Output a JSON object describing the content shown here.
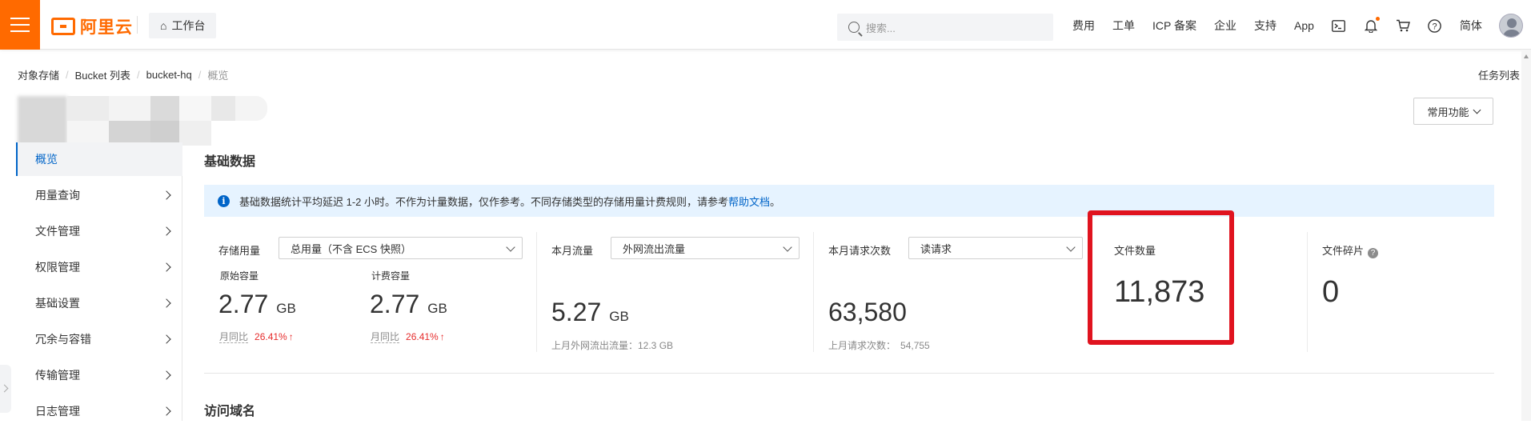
{
  "topbar": {
    "logo_text": "阿里云",
    "workbench_label": "工作台",
    "search_placeholder": "搜索...",
    "links": [
      "费用",
      "工单",
      "ICP 备案",
      "企业",
      "支持",
      "App"
    ],
    "icons": [
      "terminal-icon",
      "bell-icon",
      "cart-icon",
      "help-icon"
    ],
    "lang": "简体"
  },
  "breadcrumb": [
    "对象存储",
    "Bucket 列表",
    "bucket-hq",
    "概览"
  ],
  "task_list_label": "任务列表",
  "common_functions_label": "常用功能",
  "sidebar": {
    "items": [
      {
        "label": "概览",
        "active": true
      },
      {
        "label": "用量查询"
      },
      {
        "label": "文件管理"
      },
      {
        "label": "权限管理"
      },
      {
        "label": "基础设置"
      },
      {
        "label": "冗余与容错"
      },
      {
        "label": "传输管理"
      },
      {
        "label": "日志管理"
      }
    ]
  },
  "main": {
    "basic_data_title": "基础数据",
    "notice_text": "基础数据统计平均延迟 1-2 小时。不作为计量数据，仅作参考。不同存储类型的存储用量计费规则，请参考",
    "notice_link": "帮助文档",
    "notice_end": "。",
    "storage": {
      "label": "存储用量",
      "select": "总用量（不含 ECS 快照）",
      "raw_label": "原始容量",
      "raw_value": "2.77",
      "raw_unit": "GB",
      "billed_label": "计费容量",
      "billed_value": "2.77",
      "billed_unit": "GB",
      "yoy_label": "月同比",
      "yoy_pct": "26.41%",
      "yoy_arrow": "↑"
    },
    "traffic": {
      "label": "本月流量",
      "select": "外网流出流量",
      "value": "5.27",
      "unit": "GB",
      "prev": "上月外网流出流量：12.3 GB"
    },
    "requests": {
      "label": "本月请求次数",
      "select": "读请求",
      "value": "63,580",
      "prev_label": "上月请求次数：",
      "prev_value": "54,755"
    },
    "files": {
      "label": "文件数量",
      "value": "11,873"
    },
    "fragments": {
      "label": "文件碎片",
      "value": "0"
    },
    "access_domain_title": "访问域名"
  }
}
